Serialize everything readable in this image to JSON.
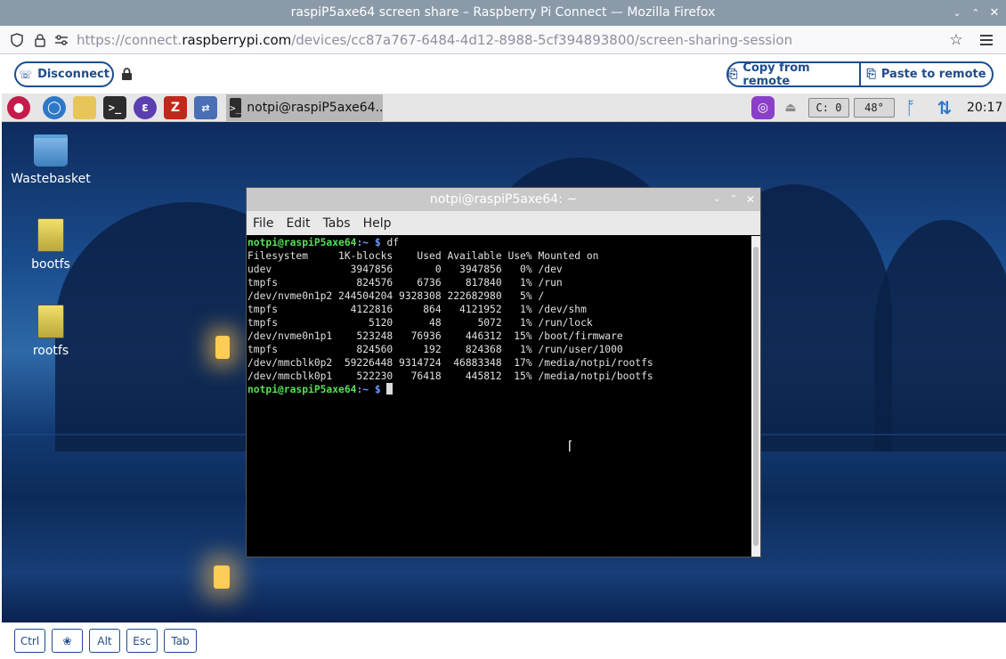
{
  "browser": {
    "title": "raspiP5axe64 screen share – Raspberry Pi Connect — Mozilla Firefox",
    "url_prefix": "https://connect.",
    "url_domain": "raspberrypi.com",
    "url_path": "/devices/cc87a767-6484-4d12-8988-5cf394893800/screen-sharing-session"
  },
  "connect_toolbar": {
    "disconnect_label": "Disconnect",
    "copy_label": "Copy from remote",
    "paste_label": "Paste to remote"
  },
  "taskbar": {
    "task_label": "notpi@raspiP5axe64..",
    "cpu_label": "C: 0",
    "temp_label": "48°",
    "clock": "20:17"
  },
  "desktop_icons": [
    {
      "label": "Wastebasket"
    },
    {
      "label": "bootfs"
    },
    {
      "label": "rootfs"
    }
  ],
  "terminal": {
    "title": "notpi@raspiP5axe64: ~",
    "menu": [
      "File",
      "Edit",
      "Tabs",
      "Help"
    ],
    "prompt_user": "notpi@raspiP5axe64",
    "prompt_path": ":~ $",
    "command": " df",
    "header": "Filesystem     1K-blocks    Used Available Use% Mounted on",
    "rows": [
      "udev             3947856       0   3947856   0% /dev",
      "tmpfs             824576    6736    817840   1% /run",
      "/dev/nvme0n1p2 244504204 9328308 222682980   5% /",
      "tmpfs            4122816     864   4121952   1% /dev/shm",
      "tmpfs               5120      48      5072   1% /run/lock",
      "/dev/nvme0n1p1    523248   76936    446312  15% /boot/firmware",
      "tmpfs             824560     192    824368   1% /run/user/1000",
      "/dev/mmcblk0p2  59226448 9314724  46883348  17% /media/notpi/rootfs",
      "/dev/mmcblk0p1    522230   76418    445812  15% /media/notpi/bootfs"
    ]
  },
  "bottom_keys": [
    "Ctrl",
    "Alt",
    "Esc",
    "Tab"
  ],
  "colors": {
    "accent": "#1e4d8c",
    "titlebar": "#8a9aa9"
  }
}
